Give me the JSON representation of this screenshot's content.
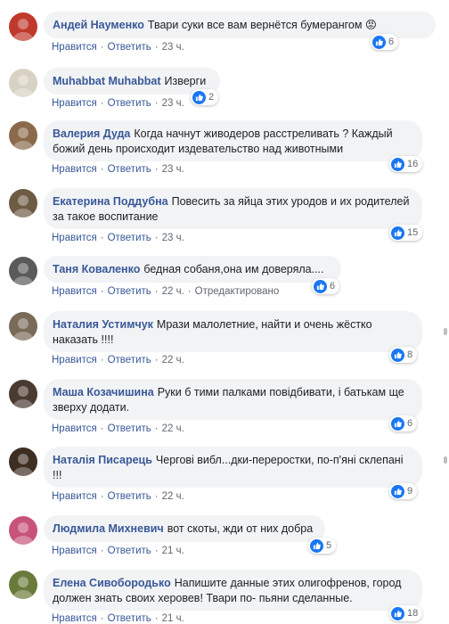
{
  "labels": {
    "like": "Нравится",
    "reply": "Ответить",
    "edited": "Отредактировано"
  },
  "comments": [
    {
      "author": "Андей Науменко",
      "text": "Твари суки все вам вернётся бумерангом 😡",
      "time": "23 ч.",
      "reactions": "6",
      "avatar_color": "#c0392b",
      "edited": false
    },
    {
      "author": "Muhabbat Muhabbat",
      "text": "Изверги",
      "time": "23 ч.",
      "reactions": "2",
      "avatar_color": "#d8d2c4",
      "edited": false
    },
    {
      "author": "Валерия Дуда",
      "text": "Когда начнут живодеров расстреливать ? Каждый божий день происходит издевательство над животными",
      "time": "23 ч.",
      "reactions": "16",
      "avatar_color": "#8a6a4a",
      "edited": false
    },
    {
      "author": "Екатерина Поддубна",
      "text": "Повесить за яйца этих уродов и их родителей за такое воспитание",
      "time": "23 ч.",
      "reactions": "15",
      "avatar_color": "#6e5b44",
      "edited": false
    },
    {
      "author": "Таня Коваленко",
      "text": "бедная собаня,она им доверяла....",
      "time": "22 ч.",
      "reactions": "6",
      "avatar_color": "#5a5a5a",
      "edited": true
    },
    {
      "author": "Наталия Устимчук",
      "text": "Мрази малолетние, найти и очень жёстко наказать !!!!",
      "time": "22 ч.",
      "reactions": "8",
      "avatar_color": "#7a6a58",
      "edited": false
    },
    {
      "author": "Маша Козачишина",
      "text": "Руки б тими палками повідбивати, і батькам ще зверху додати.",
      "time": "22 ч.",
      "reactions": "6",
      "avatar_color": "#4a3a30",
      "edited": false
    },
    {
      "author": "Наталія Писарець",
      "text": "Чергові вибл...дки-переростки, по-п'яні склепані !!!",
      "time": "22 ч.",
      "reactions": "9",
      "avatar_color": "#3e2e22",
      "edited": false
    },
    {
      "author": "Людмила Михневич",
      "text": "вот скоты, жди от них добра",
      "time": "21 ч.",
      "reactions": "5",
      "avatar_color": "#c7537a",
      "edited": false
    },
    {
      "author": "Елена Сивобородько",
      "text": "Напишите данные этих олигофренов, город должен знать своих херовев! Твари по- пьяни сделанные.",
      "time": "21 ч.",
      "reactions": "18",
      "avatar_color": "#6a7a3a",
      "edited": false
    }
  ]
}
